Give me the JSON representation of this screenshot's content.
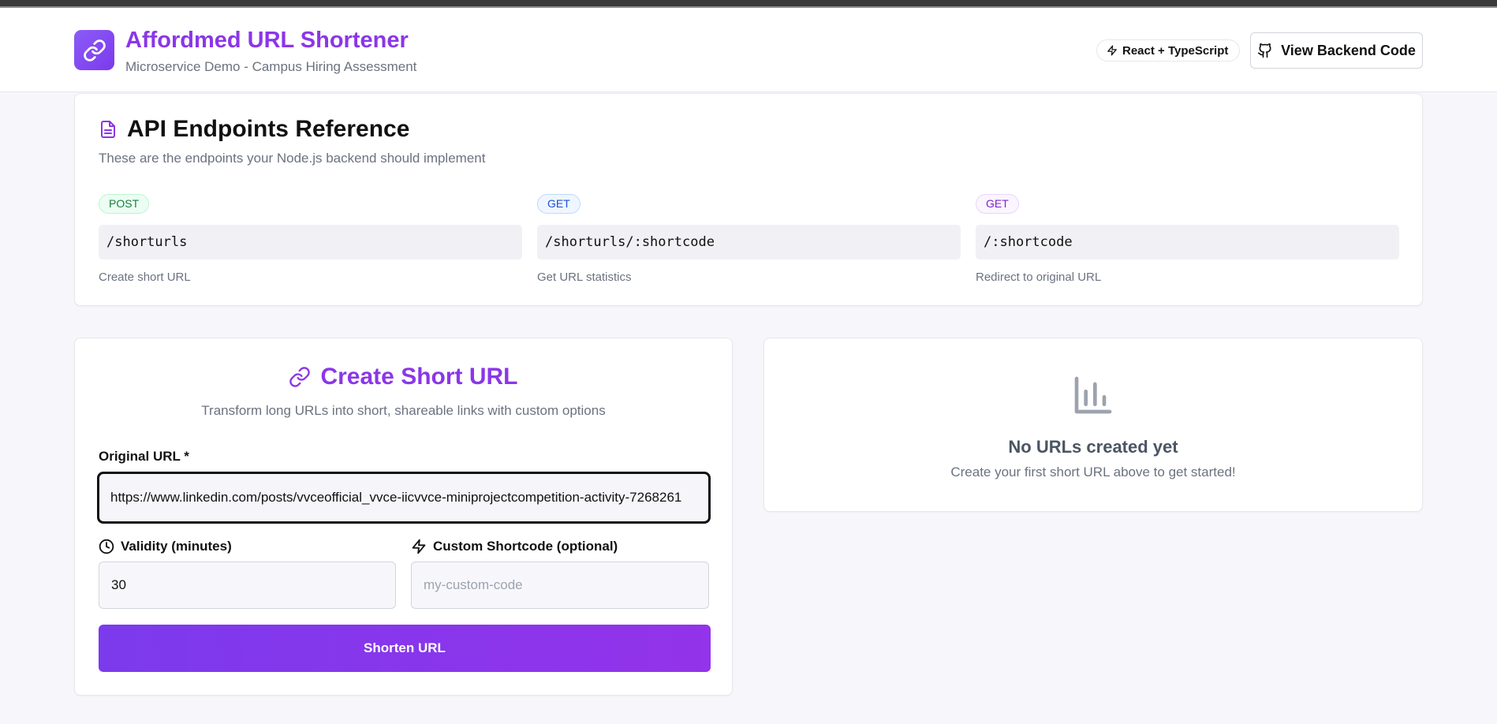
{
  "header": {
    "title": "Affordmed URL Shortener",
    "subtitle": "Microservice Demo - Campus Hiring Assessment",
    "tech_badge": "React + TypeScript",
    "backend_button": "View Backend Code"
  },
  "api": {
    "title": "API Endpoints Reference",
    "description": "These are the endpoints your Node.js backend should implement",
    "endpoints": [
      {
        "method": "POST",
        "path": "/shorturls",
        "description": "Create short URL"
      },
      {
        "method": "GET",
        "path": "/shorturls/:shortcode",
        "description": "Get URL statistics"
      },
      {
        "method": "GET",
        "path": "/:shortcode",
        "description": "Redirect to original URL"
      }
    ]
  },
  "create": {
    "title": "Create Short URL",
    "description": "Transform long URLs into short, shareable links with custom options",
    "url_label": "Original URL *",
    "url_value": "https://www.linkedin.com/posts/vvceofficial_vvce-iicvvce-miniprojectcompetition-activity-7268261",
    "validity_label": "Validity (minutes)",
    "validity_value": "30",
    "shortcode_label": "Custom Shortcode (optional)",
    "shortcode_placeholder": "my-custom-code",
    "submit_label": "Shorten URL"
  },
  "empty_state": {
    "title": "No URLs created yet",
    "description": "Create your first short URL above to get started!"
  },
  "colors": {
    "brand": "#8b36e8",
    "primary_button": "#7c3aed",
    "post_badge": "#15803d",
    "get_badge": "#1d4ed8",
    "get_redirect_badge": "#7e22ce"
  },
  "icons": {
    "logo": "link-icon",
    "tech_badge": "lightning-icon",
    "backend_button": "github-icon",
    "api_title": "document-icon",
    "create_title": "link-icon",
    "validity": "clock-icon",
    "shortcode": "lightning-icon",
    "empty_state": "bar-chart-icon"
  }
}
